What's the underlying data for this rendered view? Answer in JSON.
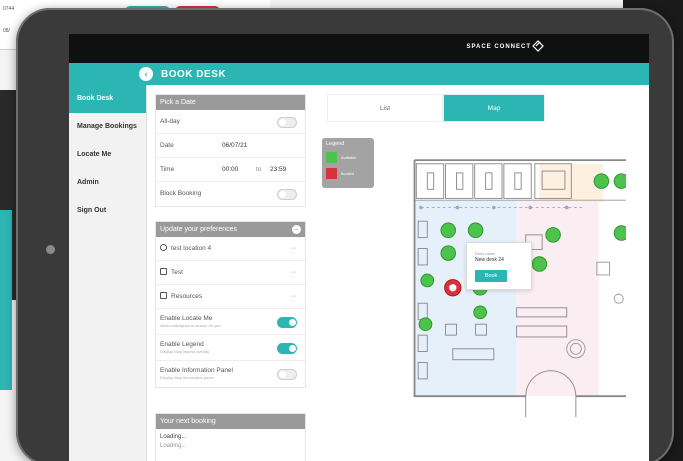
{
  "background": {
    "left_text_1": "0744",
    "left_text_2": "08/"
  },
  "header": {
    "brand": "SPACE CONNECT",
    "page_title": "BOOK DESK"
  },
  "sidebar": {
    "items": [
      {
        "label": "Book Desk",
        "active": true
      },
      {
        "label": "Manage Bookings",
        "active": false
      },
      {
        "label": "Locate Me",
        "active": false
      },
      {
        "label": "Admin",
        "active": false
      },
      {
        "label": "Sign Out",
        "active": false
      }
    ]
  },
  "pick_date": {
    "title": "Pick a Date",
    "all_day_label": "All-day",
    "all_day_on": false,
    "date_label": "Date",
    "date_value": "06/07/21",
    "time_label": "Time",
    "time_from": "00:00",
    "time_to_word": "to",
    "time_to": "23:59",
    "block_booking_label": "Block Booking",
    "block_booking_on": false
  },
  "preferences": {
    "title": "Update your preferences",
    "location": "test location 4",
    "test": "Test",
    "resources": "Resources",
    "more": "···",
    "locate_me_label": "Enable Locate Me",
    "locate_me_desc": "Allow colleagues to search for you",
    "locate_me_on": true,
    "legend_label": "Enable Legend",
    "legend_desc": "Display Map legend overlay",
    "legend_on": true,
    "info_panel_label": "Enable Information Panel",
    "info_panel_desc": "Display Map information panel",
    "info_panel_on": false
  },
  "next_booking": {
    "title": "Your next booking",
    "line1": "Loading...",
    "line2": "Loading..."
  },
  "view_tabs": [
    {
      "label": "List",
      "active": false
    },
    {
      "label": "Map",
      "active": true
    }
  ],
  "legend": {
    "title": "Legend",
    "available_label": "Available",
    "booked_label": "Booked",
    "available_color": "#4cc34a",
    "booked_color": "#d9323f"
  },
  "popup": {
    "desk_label": "Desk name",
    "desk_name": "New desk 24",
    "book_label": "Book"
  },
  "colors": {
    "accent": "#2bb6b4",
    "available": "#4cc34a",
    "booked": "#d9323f"
  }
}
